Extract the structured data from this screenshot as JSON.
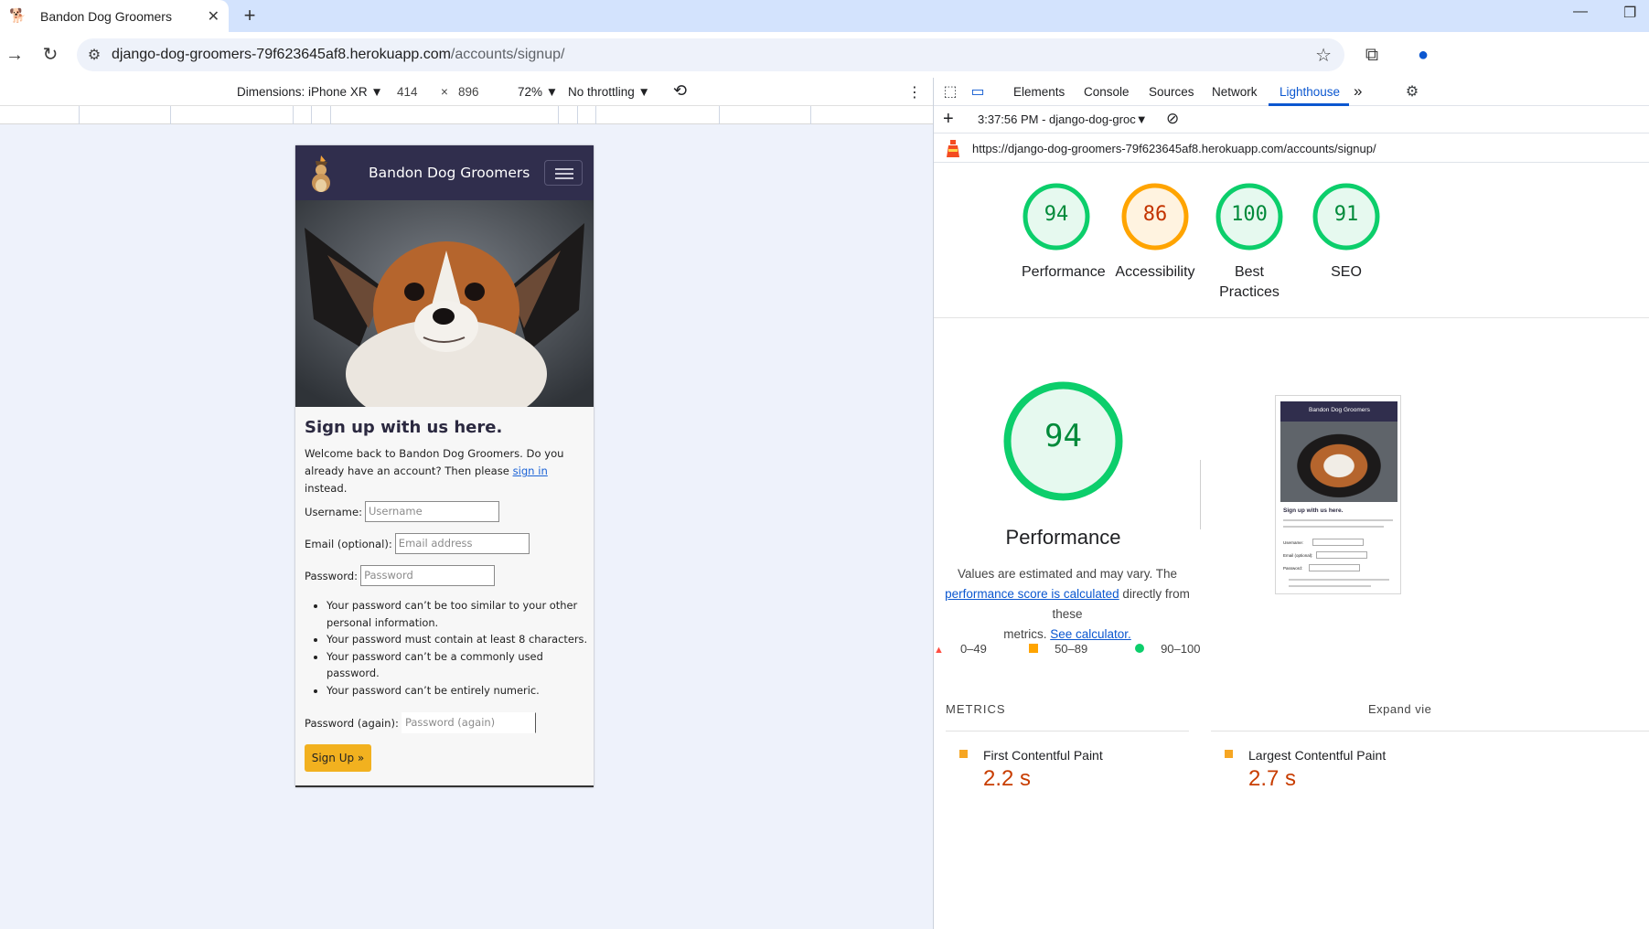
{
  "browser": {
    "tab_title": "Bandon Dog Groomers",
    "url_host": "django-dog-groomers-79f623645af8.herokuapp.com",
    "url_path": "/accounts/signup/"
  },
  "device_toolbar": {
    "dimensions_label": "Dimensions: iPhone XR ▼",
    "width": "414",
    "times": "×",
    "height": "896",
    "zoom": "72% ▼",
    "throttling": "No throttling ▼"
  },
  "site": {
    "brand": "Bandon Dog Groomers",
    "heading": "Sign up with us here.",
    "intro_prefix": "Welcome back to Bandon Dog Groomers. Do you already have an account? Then please ",
    "intro_link": "sign in",
    "intro_suffix": " instead.",
    "fields": {
      "username_label": "Username:",
      "username_placeholder": "Username",
      "email_label": "Email (optional):",
      "email_placeholder": "Email address",
      "password_label": "Password:",
      "password_placeholder": "Password",
      "password2_label": "Password (again):",
      "password2_placeholder": "Password (again)"
    },
    "help": [
      "Your password can’t be too similar to your other personal information.",
      "Your password must contain at least 8 characters.",
      "Your password can’t be a commonly used password.",
      "Your password can’t be entirely numeric."
    ],
    "submit": "Sign Up »"
  },
  "devtools": {
    "tabs": [
      "Elements",
      "Console",
      "Sources",
      "Network",
      "Lighthouse"
    ],
    "active_tab": "Lighthouse",
    "more": "»",
    "report_time": "3:37:56 PM - django-dog-groc▼",
    "report_url": "https://django-dog-groomers-79f623645af8.herokuapp.com/accounts/signup/",
    "scores": [
      {
        "label": "Performance",
        "value": "94",
        "color": "#0cce6b",
        "text_color": "#008a3a",
        "bg": "#e6f9ef"
      },
      {
        "label": "Accessibility",
        "value": "86",
        "color": "#ffa400",
        "text_color": "#c33300",
        "bg": "#fff3e0"
      },
      {
        "label": "Best Practices",
        "value": "100",
        "color": "#0cce6b",
        "text_color": "#008a3a",
        "bg": "#e6f9ef"
      },
      {
        "label": "SEO",
        "value": "91",
        "color": "#0cce6b",
        "text_color": "#008a3a",
        "bg": "#e6f9ef"
      }
    ],
    "perf_score": "94",
    "perf_title": "Performance",
    "note_line1": "Values are estimated and may vary. The",
    "note_link1": "performance score is calculated",
    "note_mid": " directly from these",
    "note_line3": "metrics. ",
    "note_link2": "See calculator.",
    "legend": [
      "0–49",
      "50–89",
      "90–100"
    ],
    "metrics_heading": "METRICS",
    "expand_label": "Expand vie",
    "metrics": [
      {
        "name": "First Contentful Paint",
        "value": "2.2 s"
      },
      {
        "name": "Largest Contentful Paint",
        "value": "2.7 s"
      }
    ],
    "thumbnail": {
      "brand": "Bandon Dog Groomers",
      "heading": "Sign up with us here.",
      "username_label": "Username:",
      "email_label": "Email (optional):",
      "password_label": "Password:"
    }
  }
}
